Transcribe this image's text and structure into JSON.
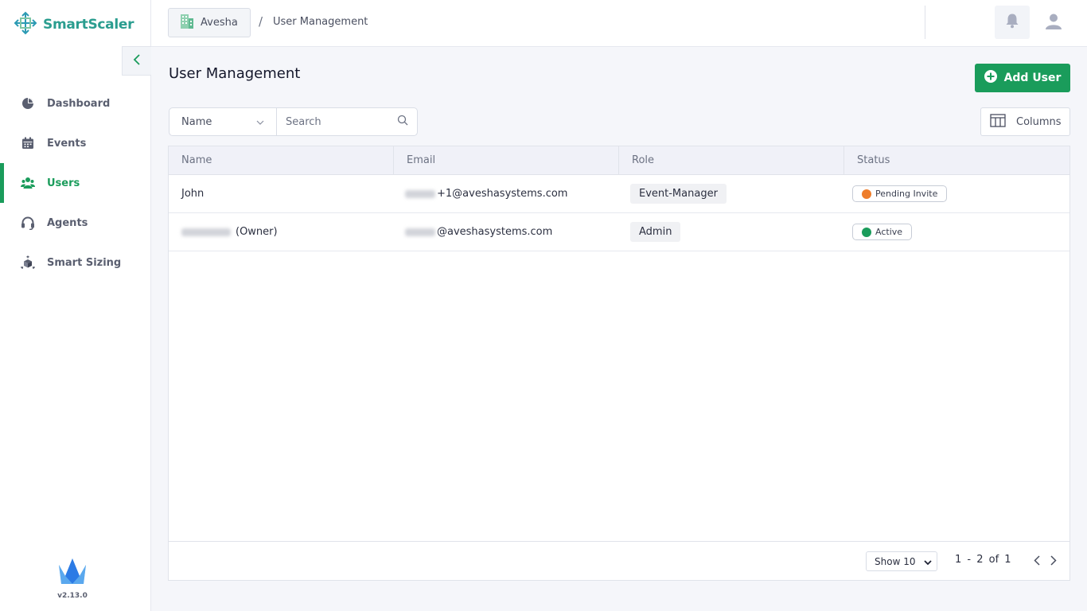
{
  "app": {
    "logo_text": "SmartScaler",
    "version": "v2.13.0",
    "accent_color": "#1a9c5b"
  },
  "sidebar": {
    "items": [
      {
        "label": "Dashboard",
        "icon": "pie-chart-icon",
        "active": false
      },
      {
        "label": "Events",
        "icon": "calendar-icon",
        "active": false
      },
      {
        "label": "Users",
        "icon": "users-icon",
        "active": true
      },
      {
        "label": "Agents",
        "icon": "headset-icon",
        "active": false
      },
      {
        "label": "Smart Sizing",
        "icon": "cube-sizing-icon",
        "active": false
      }
    ]
  },
  "header": {
    "workspace": "Avesha",
    "separator": "/",
    "breadcrumb_current": "User Management"
  },
  "main": {
    "title": "User Management",
    "add_user_label": "Add User",
    "filter_field": "Name",
    "search_placeholder": "Search",
    "columns_label": "Columns"
  },
  "table": {
    "headers": [
      "Name",
      "Email",
      "Role",
      "Status"
    ],
    "rows": [
      {
        "name": "John",
        "owner_tag": "",
        "email_suffix": "+1@aveshasystems.com",
        "role": "Event-Manager",
        "status": "Pending Invite",
        "status_color": "#ee7d2b"
      },
      {
        "name": "",
        "owner_tag": "(Owner)",
        "email_suffix": "@aveshasystems.com",
        "role": "Admin",
        "status": "Active",
        "status_color": "#1a9c5b"
      }
    ]
  },
  "pagination": {
    "show_label": "Show 10",
    "range_text": "1  -  2 of 1"
  }
}
